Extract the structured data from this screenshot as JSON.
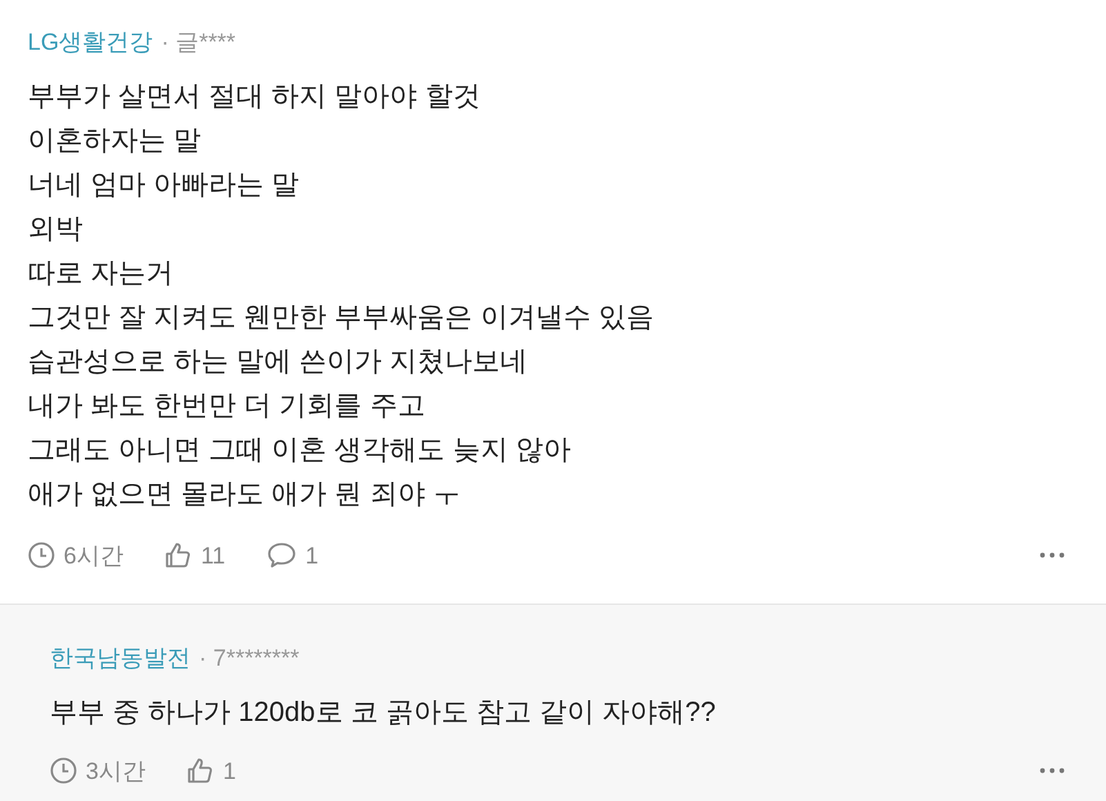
{
  "comments": [
    {
      "author": "LG생활건강",
      "user": "· 글****",
      "lines": [
        "부부가 살면서 절대 하지 말아야 할것",
        "이혼하자는 말",
        "너네 엄마 아빠라는 말",
        "외박",
        "따로 자는거",
        "그것만 잘 지켜도 웬만한 부부싸움은 이겨낼수 있음",
        "습관성으로 하는 말에 쓴이가 지쳤나보네",
        "내가 봐도 한번만 더 기회를 주고",
        "그래도 아니면 그때 이혼 생각해도 늦지 않아",
        "애가 없으면 몰라도 애가 뭔 죄야 ㅜ"
      ],
      "time": "6시간",
      "likes": "11",
      "replies": "1",
      "kind": "comment"
    },
    {
      "author": "한국남동발전",
      "user": "· 7********",
      "lines": [
        "부부 중 하나가 120db로 코 곩아도 참고 같이 자야해??"
      ],
      "time": "3시간",
      "likes": "1",
      "kind": "reply"
    }
  ]
}
